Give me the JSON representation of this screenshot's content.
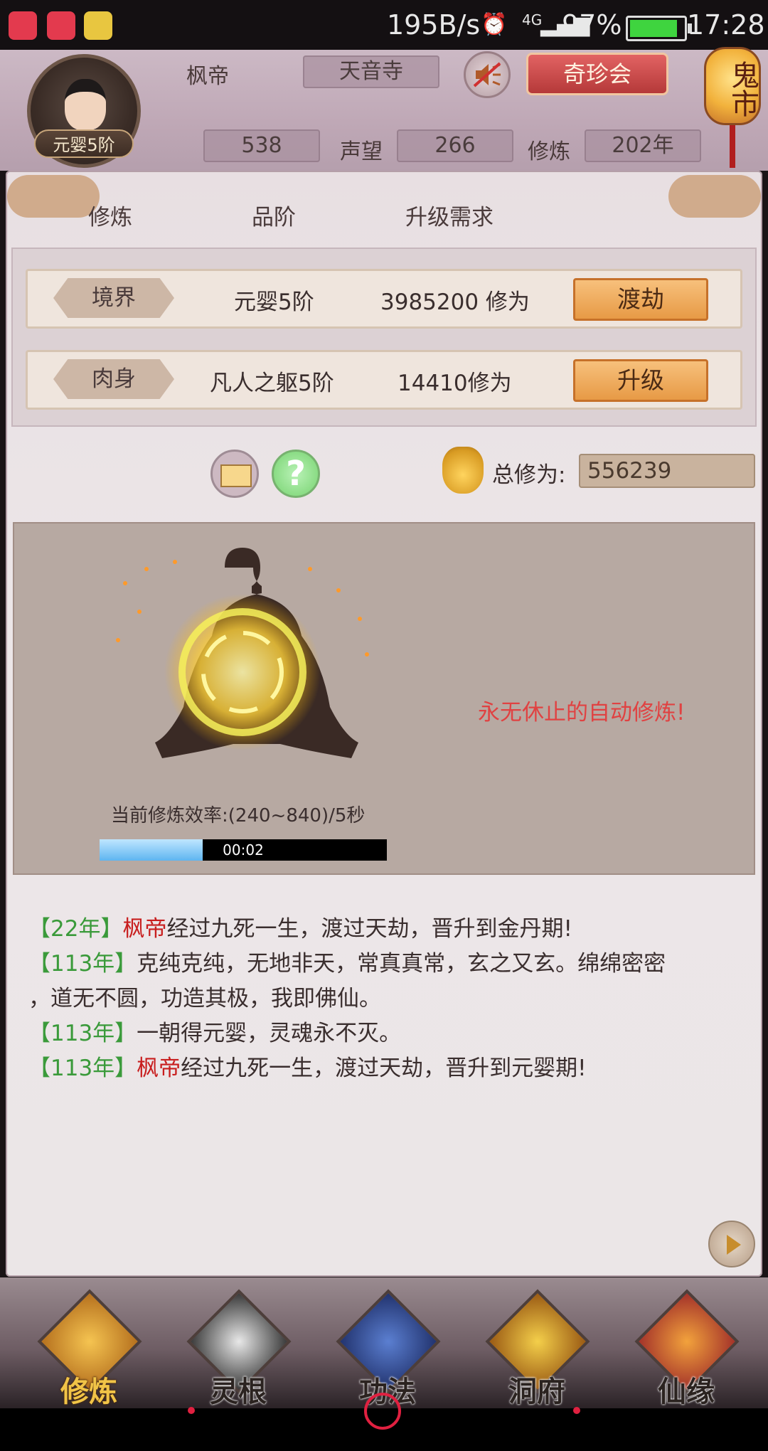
{
  "status_bar": {
    "net_speed": "195B/s",
    "signal": "4G",
    "battery": "97%",
    "battery_level": 0.97,
    "time": "17:28"
  },
  "header": {
    "player_name": "枫帝",
    "sect": "天音寺",
    "rank": "元婴5阶",
    "gems": "538",
    "reputation_label": "声望",
    "reputation": "266",
    "cultivation_label": "修炼",
    "cultivation_years": "202年",
    "treasure_button": "奇珍会",
    "lantern_text": "鬼市"
  },
  "columns": [
    "修炼",
    "品阶",
    "升级需求"
  ],
  "rows": [
    {
      "tag": "境界",
      "grade": "元婴5阶",
      "requirement": "3985200 修为",
      "button": "渡劫"
    },
    {
      "tag": "肉身",
      "grade": "凡人之躯5阶",
      "requirement": "14410修为",
      "button": "升级"
    }
  ],
  "total": {
    "label": "总修为:",
    "value": "556239"
  },
  "cultivate": {
    "auto_text": "永无休止的自动修炼!",
    "rate_text": "当前修炼效率:(240~840)/5秒",
    "timer": "00:02",
    "timer_progress": 0.36
  },
  "log": [
    {
      "year": "22年",
      "name": "枫帝",
      "text": "经过九死一生，渡过天劫，晋升到金丹期!"
    },
    {
      "year": "113年",
      "name": "",
      "text": "克纯克纯，无地非天，常真真常，玄之又玄。绵绵密密"
    },
    {
      "year": "",
      "name": "",
      "text": "，道无不圆，功造其极，我即佛仙。"
    },
    {
      "year": "113年",
      "name": "",
      "text": "一朝得元婴，灵魂永不灭。"
    },
    {
      "year": "113年",
      "name": "枫帝",
      "text": "经过九死一生，渡过天劫，晋升到元婴期!"
    }
  ],
  "nav": [
    "修炼",
    "灵根",
    "功法",
    "洞府",
    "仙缘"
  ],
  "colors": {
    "accent_red": "#e04242",
    "year_green": "#3a9a3a",
    "name_red": "#c81e1e",
    "button_orange": "#e79a46"
  }
}
